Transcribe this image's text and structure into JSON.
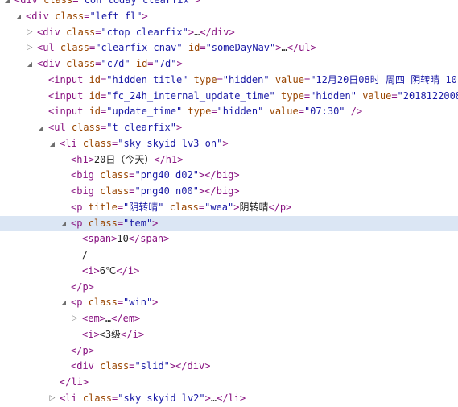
{
  "rows": [
    {
      "indent": 0,
      "toggle": "open",
      "parts": [
        [
          "t",
          "<div "
        ],
        [
          "a",
          "class"
        ],
        [
          "t",
          "="
        ],
        [
          "v",
          "\"con today clearfix\""
        ],
        [
          "t",
          ">"
        ]
      ]
    },
    {
      "indent": 1,
      "toggle": "open",
      "parts": [
        [
          "t",
          "<div "
        ],
        [
          "a",
          "class"
        ],
        [
          "t",
          "="
        ],
        [
          "v",
          "\"left fl\""
        ],
        [
          "t",
          ">"
        ]
      ]
    },
    {
      "indent": 2,
      "toggle": "closed",
      "parts": [
        [
          "t",
          "<div "
        ],
        [
          "a",
          "class"
        ],
        [
          "t",
          "="
        ],
        [
          "v",
          "\"ctop clearfix\""
        ],
        [
          "t",
          ">"
        ],
        [
          "e",
          "…"
        ],
        [
          "t",
          "</div>"
        ]
      ]
    },
    {
      "indent": 2,
      "toggle": "closed",
      "parts": [
        [
          "t",
          "<ul "
        ],
        [
          "a",
          "class"
        ],
        [
          "t",
          "="
        ],
        [
          "v",
          "\"clearfix cnav\""
        ],
        [
          "t",
          " "
        ],
        [
          "a",
          "id"
        ],
        [
          "t",
          "="
        ],
        [
          "v",
          "\"someDayNav\""
        ],
        [
          "t",
          ">"
        ],
        [
          "e",
          "…"
        ],
        [
          "t",
          "</ul>"
        ]
      ]
    },
    {
      "indent": 2,
      "toggle": "open",
      "parts": [
        [
          "t",
          "<div "
        ],
        [
          "a",
          "class"
        ],
        [
          "t",
          "="
        ],
        [
          "v",
          "\"c7d\""
        ],
        [
          "t",
          " "
        ],
        [
          "a",
          "id"
        ],
        [
          "t",
          "="
        ],
        [
          "v",
          "\"7d\""
        ],
        [
          "t",
          ">"
        ]
      ]
    },
    {
      "indent": 3,
      "toggle": "none",
      "parts": [
        [
          "t",
          "<input "
        ],
        [
          "a",
          "id"
        ],
        [
          "t",
          "="
        ],
        [
          "v",
          "\"hidden_title\""
        ],
        [
          "t",
          " "
        ],
        [
          "a",
          "type"
        ],
        [
          "t",
          "="
        ],
        [
          "v",
          "\"hidden\""
        ],
        [
          "t",
          " "
        ],
        [
          "a",
          "value"
        ],
        [
          "t",
          "="
        ],
        [
          "v",
          "\"12月20日08时 周四 阴转晴 10"
        ]
      ]
    },
    {
      "indent": 3,
      "toggle": "none",
      "parts": [
        [
          "t",
          "<input "
        ],
        [
          "a",
          "id"
        ],
        [
          "t",
          "="
        ],
        [
          "v",
          "\"fc_24h_internal_update_time\""
        ],
        [
          "t",
          " "
        ],
        [
          "a",
          "type"
        ],
        [
          "t",
          "="
        ],
        [
          "v",
          "\"hidden\""
        ],
        [
          "t",
          " "
        ],
        [
          "a",
          "value"
        ],
        [
          "t",
          "="
        ],
        [
          "v",
          "\"2018122008"
        ]
      ]
    },
    {
      "indent": 3,
      "toggle": "none",
      "parts": [
        [
          "t",
          "<input "
        ],
        [
          "a",
          "id"
        ],
        [
          "t",
          "="
        ],
        [
          "v",
          "\"update_time\""
        ],
        [
          "t",
          " "
        ],
        [
          "a",
          "type"
        ],
        [
          "t",
          "="
        ],
        [
          "v",
          "\"hidden\""
        ],
        [
          "t",
          " "
        ],
        [
          "a",
          "value"
        ],
        [
          "t",
          "="
        ],
        [
          "v",
          "\"07:30\""
        ],
        [
          "t",
          " />"
        ]
      ]
    },
    {
      "indent": 3,
      "toggle": "open",
      "parts": [
        [
          "t",
          "<ul "
        ],
        [
          "a",
          "class"
        ],
        [
          "t",
          "="
        ],
        [
          "v",
          "\"t clearfix\""
        ],
        [
          "t",
          ">"
        ]
      ]
    },
    {
      "indent": 4,
      "toggle": "open",
      "parts": [
        [
          "t",
          "<li "
        ],
        [
          "a",
          "class"
        ],
        [
          "t",
          "="
        ],
        [
          "v",
          "\"sky skyid lv3 on\""
        ],
        [
          "t",
          ">"
        ]
      ]
    },
    {
      "indent": 5,
      "toggle": "none",
      "parts": [
        [
          "t",
          "<h1>"
        ],
        [
          "x",
          "20日（今天）"
        ],
        [
          "t",
          "</h1>"
        ]
      ]
    },
    {
      "indent": 5,
      "toggle": "none",
      "parts": [
        [
          "t",
          "<big "
        ],
        [
          "a",
          "class"
        ],
        [
          "t",
          "="
        ],
        [
          "v",
          "\"png40 d02\""
        ],
        [
          "t",
          "></big>"
        ]
      ]
    },
    {
      "indent": 5,
      "toggle": "none",
      "parts": [
        [
          "t",
          "<big "
        ],
        [
          "a",
          "class"
        ],
        [
          "t",
          "="
        ],
        [
          "v",
          "\"png40 n00\""
        ],
        [
          "t",
          "></big>"
        ]
      ]
    },
    {
      "indent": 5,
      "toggle": "none",
      "parts": [
        [
          "t",
          "<p "
        ],
        [
          "a",
          "title"
        ],
        [
          "t",
          "="
        ],
        [
          "v",
          "\"阴转晴\""
        ],
        [
          "t",
          " "
        ],
        [
          "a",
          "class"
        ],
        [
          "t",
          "="
        ],
        [
          "v",
          "\"wea\""
        ],
        [
          "t",
          ">"
        ],
        [
          "x",
          "阴转晴"
        ],
        [
          "t",
          "</p>"
        ]
      ]
    },
    {
      "indent": 5,
      "toggle": "open",
      "selected": true,
      "parts": [
        [
          "t",
          "<p "
        ],
        [
          "a",
          "class"
        ],
        [
          "t",
          "="
        ],
        [
          "v",
          "\"tem\""
        ],
        [
          "t",
          ">"
        ]
      ]
    },
    {
      "indent": 6,
      "toggle": "none",
      "parts": [
        [
          "t",
          "<span>"
        ],
        [
          "x",
          "10"
        ],
        [
          "t",
          "</span>"
        ]
      ]
    },
    {
      "indent": 6,
      "toggle": "none",
      "parts": [
        [
          "x",
          "/"
        ]
      ]
    },
    {
      "indent": 6,
      "toggle": "none",
      "parts": [
        [
          "t",
          "<i>"
        ],
        [
          "x",
          "6℃"
        ],
        [
          "t",
          "</i>"
        ]
      ]
    },
    {
      "indent": 5,
      "toggle": "none",
      "parts": [
        [
          "t",
          "</p>"
        ]
      ]
    },
    {
      "indent": 5,
      "toggle": "open",
      "parts": [
        [
          "t",
          "<p "
        ],
        [
          "a",
          "class"
        ],
        [
          "t",
          "="
        ],
        [
          "v",
          "\"win\""
        ],
        [
          "t",
          ">"
        ]
      ]
    },
    {
      "indent": 6,
      "toggle": "closed",
      "parts": [
        [
          "t",
          "<em>"
        ],
        [
          "e",
          "…"
        ],
        [
          "t",
          "</em>"
        ]
      ]
    },
    {
      "indent": 6,
      "toggle": "none",
      "parts": [
        [
          "t",
          "<i>"
        ],
        [
          "x",
          "<3级"
        ],
        [
          "t",
          "</i>"
        ]
      ]
    },
    {
      "indent": 5,
      "toggle": "none",
      "parts": [
        [
          "t",
          "</p>"
        ]
      ]
    },
    {
      "indent": 5,
      "toggle": "none",
      "parts": [
        [
          "t",
          "<div "
        ],
        [
          "a",
          "class"
        ],
        [
          "t",
          "="
        ],
        [
          "v",
          "\"slid\""
        ],
        [
          "t",
          "></div>"
        ]
      ]
    },
    {
      "indent": 4,
      "toggle": "none",
      "parts": [
        [
          "t",
          "</li>"
        ]
      ]
    },
    {
      "indent": 4,
      "toggle": "closed",
      "parts": [
        [
          "t",
          "<li "
        ],
        [
          "a",
          "class"
        ],
        [
          "t",
          "="
        ],
        [
          "v",
          "\"sky skyid lv2\""
        ],
        [
          "t",
          ">"
        ],
        [
          "e",
          "…"
        ],
        [
          "t",
          "</li>"
        ]
      ]
    }
  ],
  "icons": {
    "open": "triangle-down-icon",
    "closed": "triangle-right-icon"
  },
  "colors": {
    "tag": "#881280",
    "attribute": "#994500",
    "value": "#1a1aa6",
    "text": "#222222",
    "selection": "#dbe6f4"
  }
}
